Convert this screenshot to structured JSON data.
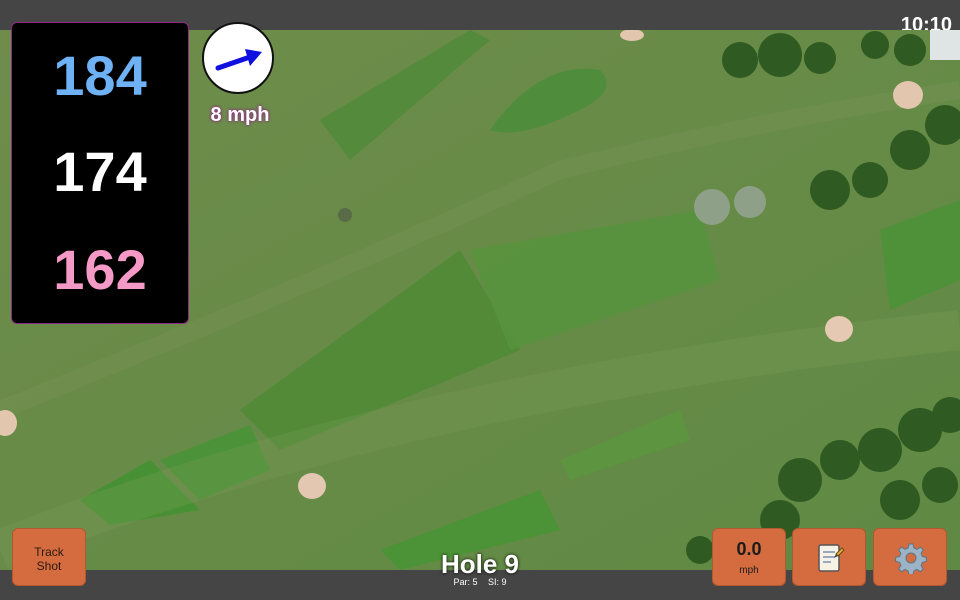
{
  "status_bar": {
    "time": "10:10"
  },
  "distances": {
    "back": "184",
    "middle": "174",
    "front": "162"
  },
  "wind": {
    "speed": "8 mph",
    "direction_icon": "wind-arrow-icon"
  },
  "buttons": {
    "track_shot": "Track Shot",
    "speed_value": "0.0",
    "speed_unit": "mph",
    "notes_icon": "notepad-icon",
    "settings_icon": "gear-icon"
  },
  "hole": {
    "title": "Hole 9",
    "par": "Par: 5",
    "si": "SI: 9"
  },
  "colors": {
    "back": "#6eb1f5",
    "middle": "#ffffff",
    "front": "#f59ac6",
    "button": "#d46c3f",
    "bar": "#454545"
  }
}
